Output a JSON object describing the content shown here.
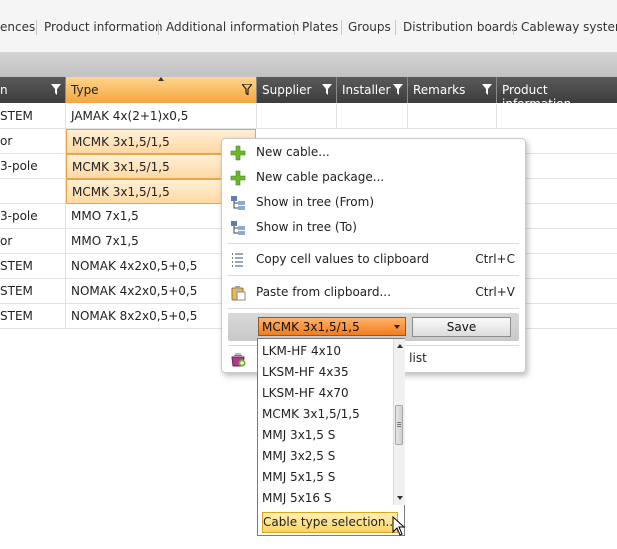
{
  "tabs": [
    "ences",
    "Product information",
    "Additional information",
    "Plates",
    "Groups",
    "Distribution boards",
    "Cableway systems"
  ],
  "columns": {
    "first_label": "n",
    "type": "Type",
    "supplier": "Supplier",
    "installer": "Installer",
    "remarks": "Remarks",
    "product_info": "Product information"
  },
  "rows": [
    {
      "c1": "STEM",
      "type": "JAMAK 4x(2+1)x0,5",
      "highlight": false
    },
    {
      "c1": "or",
      "type": "MCMK 3x1,5/1,5",
      "highlight": true
    },
    {
      "c1": " 3-pole",
      "type": "MCMK 3x1,5/1,5",
      "highlight": true
    },
    {
      "c1": "",
      "type": "MCMK 3x1,5/1,5",
      "highlight": true
    },
    {
      "c1": " 3-pole",
      "type": "MMO 7x1,5",
      "highlight": false
    },
    {
      "c1": "or",
      "type": "MMO 7x1,5",
      "highlight": false
    },
    {
      "c1": "STEM",
      "type": "NOMAK 4x2x0,5+0,5",
      "highlight": false
    },
    {
      "c1": "STEM",
      "type": "NOMAK 4x2x0,5+0,5",
      "highlight": false
    },
    {
      "c1": "STEM",
      "type": "NOMAK 8x2x0,5+0,5",
      "highlight": false
    }
  ],
  "context_menu": {
    "new_cable": "New cable...",
    "new_cable_package": "New cable package...",
    "show_tree_from": "Show in tree (From)",
    "show_tree_to": "Show in tree (To)",
    "copy_cells": "Copy cell values to clipboard",
    "copy_shortcut": "Ctrl+C",
    "paste": "Paste from clipboard...",
    "paste_shortcut": "Ctrl+V",
    "combo_value": "MCMK 3x1,5/1,5",
    "save": "Save",
    "partial_item": "o list"
  },
  "dropdown": {
    "items": [
      "LKM-HF 4x10",
      "LKSM-HF 4x35",
      "LKSM-HF 4x70",
      "MCMK 3x1,5/1,5",
      "MMJ 3x1,5 S",
      "MMJ 3x2,5 S",
      "MMJ 5x1,5 S",
      "MMJ 5x16 S"
    ],
    "button": "Cable type selection..."
  },
  "colors": {
    "header_dark": "#4a4a4a",
    "header_sorted": "#f6b04e",
    "highlight_cell": "#ffd9a3",
    "combo": "#f27c1f",
    "plus_icon": "#6bb82e"
  }
}
